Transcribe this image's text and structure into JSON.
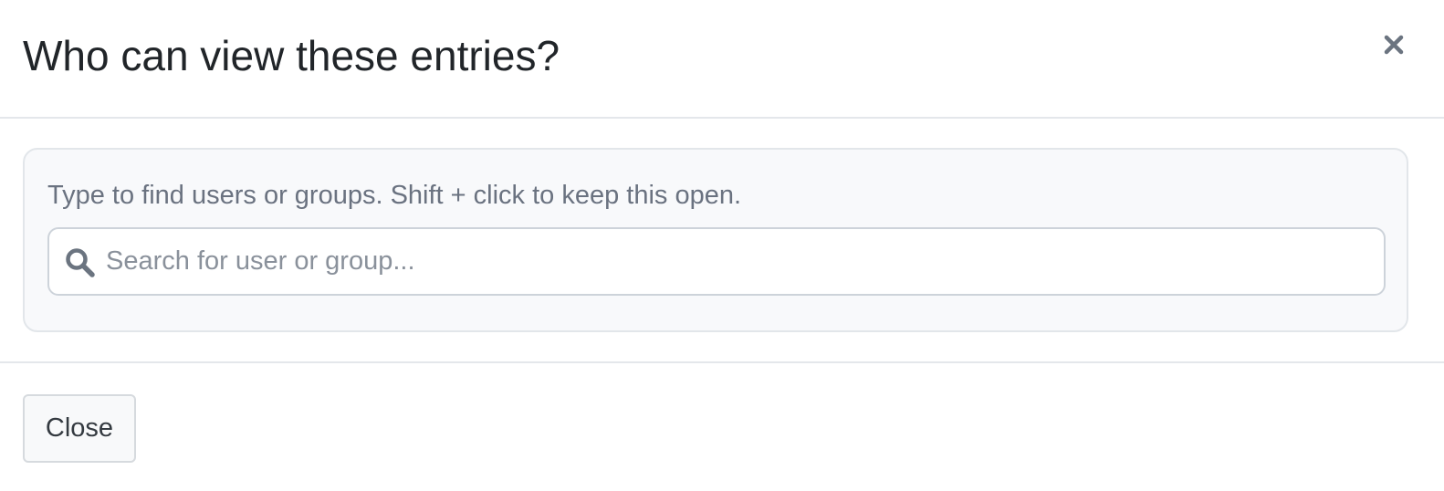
{
  "dialog": {
    "title": "Who can view these entries?",
    "close_icon": "close-icon"
  },
  "search": {
    "helper_text": "Type to find users or groups. Shift + click to keep this open.",
    "placeholder": "Search for user or group...",
    "value": "",
    "icon": "search-icon"
  },
  "footer": {
    "close_label": "Close"
  },
  "colors": {
    "title": "#212529",
    "helper_text": "#6a7280",
    "panel_background": "#f8f9fb",
    "border": "#e4e7eb",
    "icon": "#6b7480"
  }
}
